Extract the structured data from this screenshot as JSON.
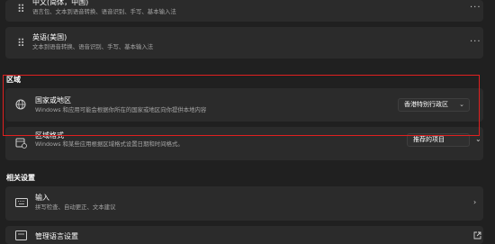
{
  "languages": [
    {
      "title": "中文(简体，中国)",
      "subtitle": "语言包、文本到语音转换、语音识别、手写、基本输入法",
      "more": "···"
    },
    {
      "title": "英语(美国)",
      "subtitle": "文本到语音转换、语音识别、手写、基本输入法",
      "more": "···"
    }
  ],
  "region_section": {
    "heading": "区域"
  },
  "country": {
    "title": "国家或地区",
    "subtitle": "Windows 和应用可能会根据你所在的国家或地区向你提供本地内容",
    "selected": "香港特别行政区",
    "icon": "globe-icon"
  },
  "format": {
    "title": "区域格式",
    "subtitle": "Windows 和某些应用根据区域格式设置日期和时间格式。",
    "selected": "推荐的项目",
    "icon": "calendar-globe-icon"
  },
  "related_section": {
    "heading": "相关设置"
  },
  "input": {
    "title": "输入",
    "subtitle": "拼写检查、自动更正、文本建议",
    "icon": "keyboard-icon"
  },
  "admin_lang": {
    "title": "管理语言设置",
    "icon": "admin-language-icon"
  },
  "colors": {
    "highlight": "#e02020",
    "background": "#202020",
    "card": "#2b2b2b"
  }
}
